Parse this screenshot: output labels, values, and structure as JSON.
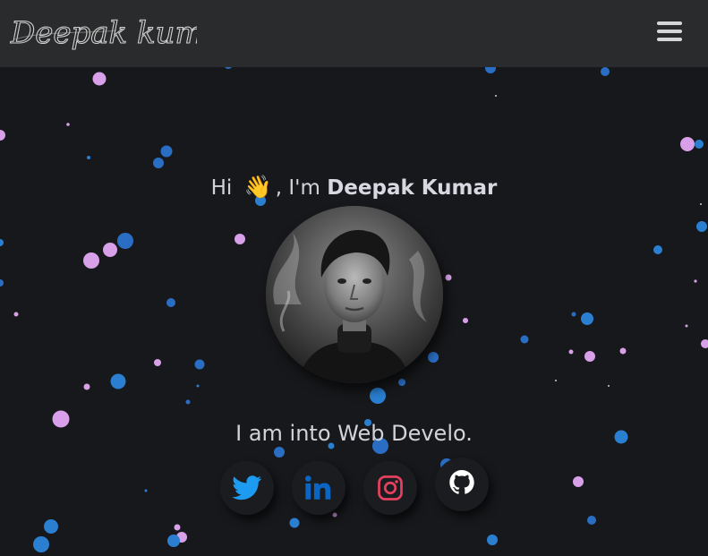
{
  "nav": {
    "logo_text": "Deepak kumar",
    "menu_icon": "hamburger-menu-icon"
  },
  "hero": {
    "greeting_prefix": "Hi",
    "wave_emoji": "👋",
    "greeting_mid": ", I'm",
    "name": "Deepak Kumar",
    "tagline": "I am into Web Develo.",
    "avatar": "profile-photo"
  },
  "socials": [
    {
      "name": "twitter",
      "icon": "twitter-icon",
      "color": "#1d9bf0"
    },
    {
      "name": "linkedin",
      "icon": "linkedin-icon",
      "color": "#0a66c2"
    },
    {
      "name": "instagram",
      "icon": "instagram-icon",
      "color": "#e4405f"
    },
    {
      "name": "github",
      "icon": "github-icon",
      "color": "#ffffff"
    }
  ],
  "colors": {
    "background": "#17181b",
    "navbar": "#2a2b2c",
    "particle_blue": "#2b7fd1",
    "particle_pink": "#d8a0e8",
    "text": "#d2d2d8"
  }
}
